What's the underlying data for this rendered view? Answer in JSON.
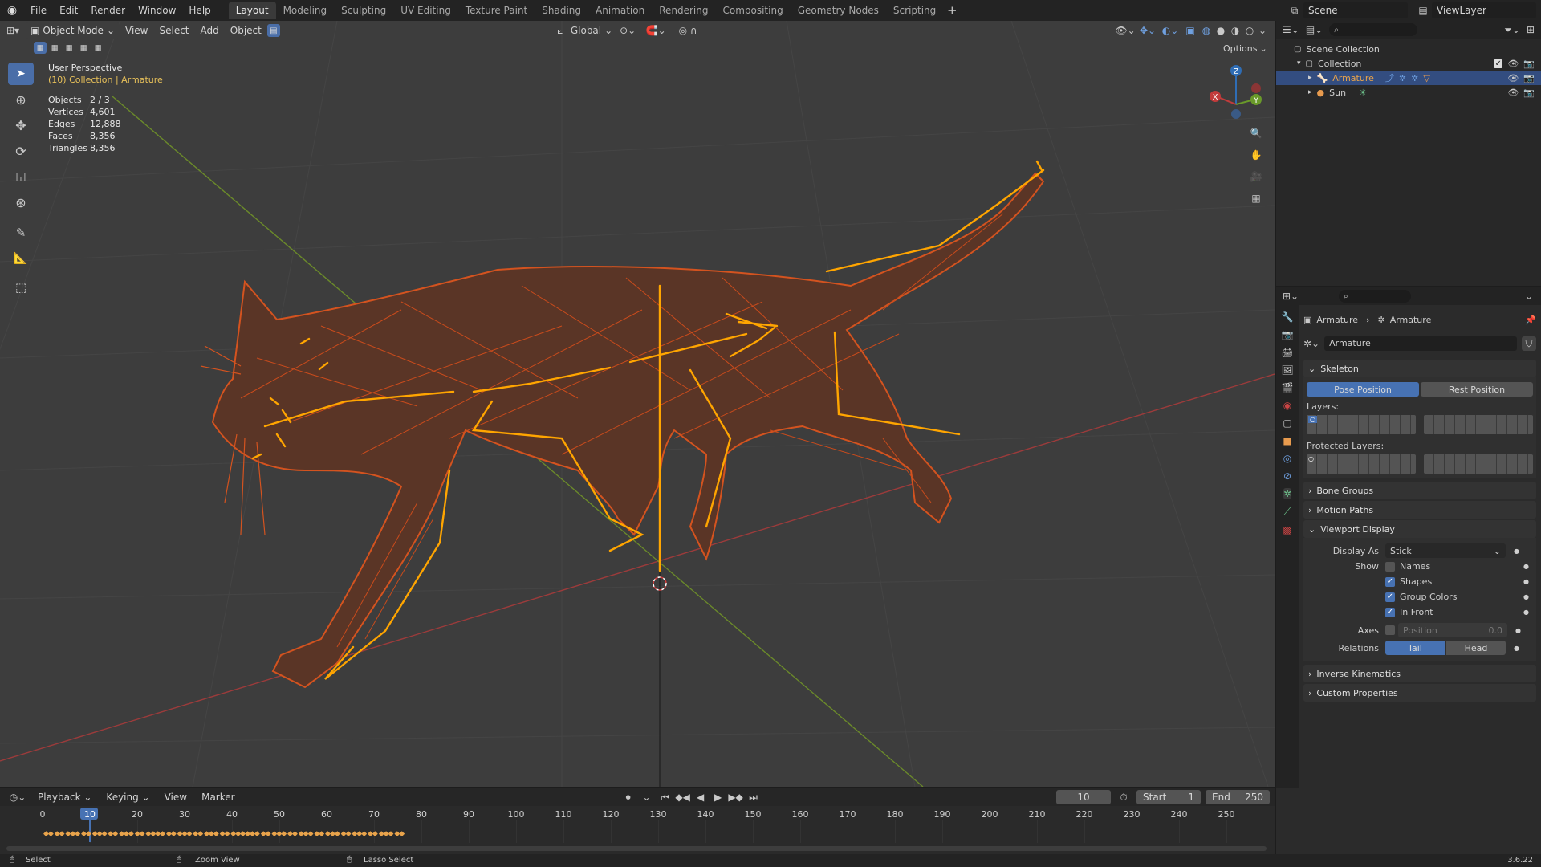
{
  "topbar": {
    "menus": [
      "File",
      "Edit",
      "Render",
      "Window",
      "Help"
    ],
    "workspaces": [
      "Layout",
      "Modeling",
      "Sculpting",
      "UV Editing",
      "Texture Paint",
      "Shading",
      "Animation",
      "Rendering",
      "Compositing",
      "Geometry Nodes",
      "Scripting"
    ],
    "active_workspace": "Layout",
    "scene": "Scene",
    "view_layer": "ViewLayer"
  },
  "viewport_header": {
    "mode": "Object Mode",
    "menus": [
      "View",
      "Select",
      "Add",
      "Object"
    ],
    "transform_orientation": "Global",
    "options": "Options"
  },
  "viewport": {
    "perspective": "User Perspective",
    "collection": "(10) Collection | Armature",
    "stats": [
      {
        "label": "Objects",
        "value": "2 / 3"
      },
      {
        "label": "Vertices",
        "value": "4,601"
      },
      {
        "label": "Edges",
        "value": "12,888"
      },
      {
        "label": "Faces",
        "value": "8,356"
      },
      {
        "label": "Triangles",
        "value": "8,356"
      }
    ],
    "gizmo_axes": {
      "z": "Z",
      "y": "Y",
      "x": "X"
    },
    "colors": {
      "background": "#3d3d3d",
      "wireframe": "#d4531f",
      "bones": "#ffa500",
      "x_axis": "#9c3b3b",
      "y_axis": "#6b8a2a"
    }
  },
  "outliner": {
    "root": "Scene Collection",
    "collection": "Collection",
    "items": [
      {
        "name": "Armature",
        "selected": true
      },
      {
        "name": "Sun",
        "selected": false
      }
    ]
  },
  "properties": {
    "breadcrumb": [
      "Armature",
      "Armature"
    ],
    "data_name": "Armature",
    "skeleton": {
      "title": "Skeleton",
      "pose_position": "Pose Position",
      "rest_position": "Rest Position",
      "layers_label": "Layers:",
      "protected_layers_label": "Protected Layers:"
    },
    "collapsed_panels": [
      "Bone Groups",
      "Motion Paths"
    ],
    "viewport_display": {
      "title": "Viewport Display",
      "display_as_label": "Display As",
      "display_as_value": "Stick",
      "show_label": "Show",
      "show_items": [
        {
          "label": "Names",
          "checked": false
        },
        {
          "label": "Shapes",
          "checked": true
        },
        {
          "label": "Group Colors",
          "checked": true
        },
        {
          "label": "In Front",
          "checked": true
        }
      ],
      "axes_label": "Axes",
      "axes_position_label": "Position",
      "axes_position_value": "0.0",
      "relations_label": "Relations",
      "relations_tail": "Tail",
      "relations_head": "Head"
    },
    "bottom_panels": [
      "Inverse Kinematics",
      "Custom Properties"
    ]
  },
  "timeline": {
    "menus": [
      "Playback",
      "Keying",
      "View",
      "Marker"
    ],
    "current_frame": "10",
    "start_label": "Start",
    "start_value": "1",
    "end_label": "End",
    "end_value": "250",
    "ruler": [
      "0",
      "10",
      "20",
      "30",
      "40",
      "50",
      "60",
      "70",
      "80",
      "90",
      "100",
      "110",
      "120",
      "130",
      "140",
      "150",
      "160",
      "170",
      "180",
      "190",
      "200",
      "210",
      "220",
      "230",
      "240",
      "250"
    ]
  },
  "statusbar": {
    "select": "Select",
    "zoom_view": "Zoom View",
    "lasso_select": "Lasso Select",
    "version": "3.6.22"
  }
}
